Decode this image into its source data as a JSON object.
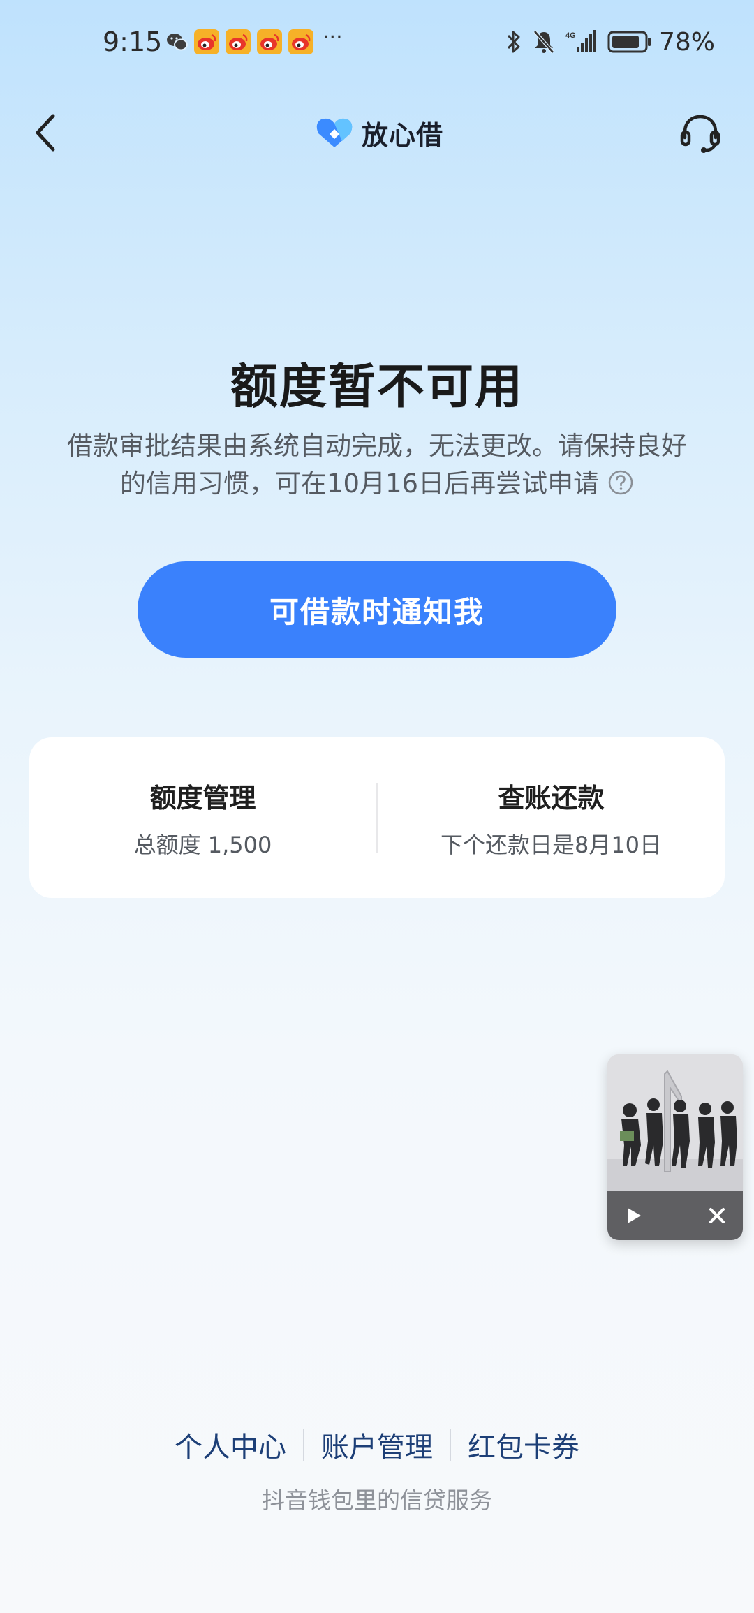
{
  "status_bar": {
    "time": "9:15",
    "more_indicator": "···",
    "notifications": [
      "wechat-icon",
      "weibo-icon",
      "weibo-icon",
      "weibo-icon",
      "weibo-icon"
    ],
    "battery_percent": "78%",
    "network_label": "4G"
  },
  "header": {
    "brand_name": "放心借",
    "brand_color": "#3b8bff"
  },
  "main": {
    "title": "额度暂不可用",
    "description": "借款审批结果由系统自动完成，无法更改。请保持良好的信用习惯，可在10月16日后再尝试申请",
    "notify_button_label": "可借款时通知我",
    "accent_color": "#3a81fc"
  },
  "card": {
    "left": {
      "title": "额度管理",
      "subtitle": "总额度 1,500"
    },
    "right": {
      "title": "查账还款",
      "subtitle": "下个还款日是8月10日"
    }
  },
  "footer": {
    "links": [
      "个人中心",
      "账户管理",
      "红包卡券"
    ],
    "caption": "抖音钱包里的信贷服务",
    "link_color": "#1d3f77"
  }
}
